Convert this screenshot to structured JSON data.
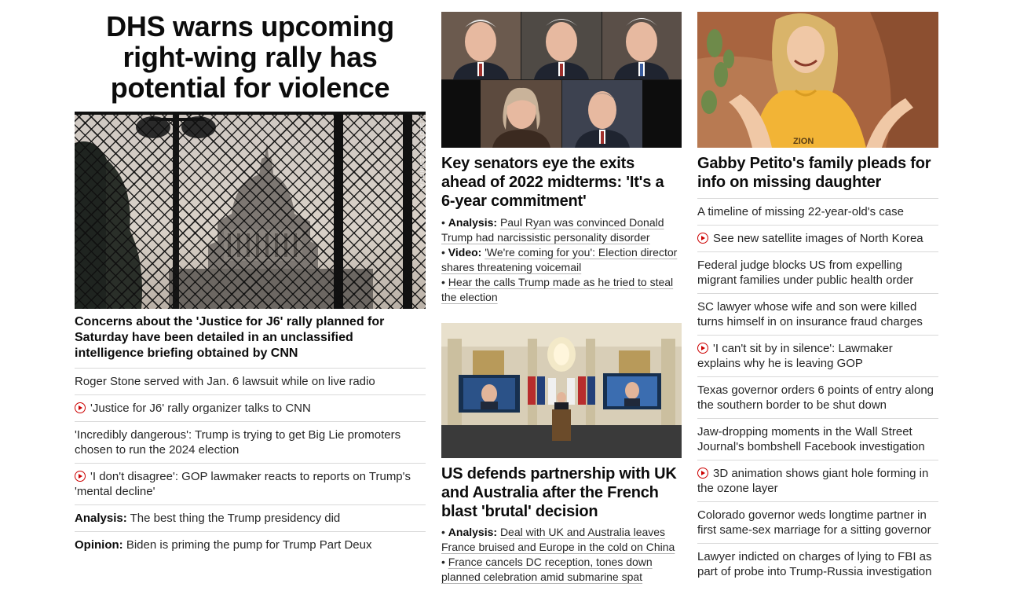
{
  "col1": {
    "title": "DHS warns upcoming right-wing rally has potential for violence",
    "image_credit": "J. SCOTT APPLEWHITE/AP",
    "caption": "Concerns about the 'Justice for J6' rally planned for Saturday have been detailed in an unclassified intelligence briefing obtained by CNN",
    "links": [
      {
        "label": "",
        "text": "Roger Stone served with Jan. 6 lawsuit while on live radio",
        "video": false
      },
      {
        "label": "",
        "text": "'Justice for J6' rally organizer talks to CNN",
        "video": true
      },
      {
        "label": "",
        "text": "'Incredibly dangerous': Trump is trying to get Big Lie promoters chosen to run the 2024 election",
        "video": false
      },
      {
        "label": "",
        "text": "'I don't disagree': GOP lawmaker reacts to reports on Trump's 'mental decline'",
        "video": true
      },
      {
        "label": "Analysis:",
        "text": "The best thing the Trump presidency did",
        "video": false
      },
      {
        "label": "Opinion:",
        "text": "Biden is priming the pump for Trump Part Deux",
        "video": false
      }
    ]
  },
  "col2": {
    "story1": {
      "headline": "Key senators eye the exits ahead of 2022 midterms: 'It's a 6-year commitment'",
      "bullets": [
        {
          "label": "Analysis:",
          "text": "Paul Ryan was convinced Donald Trump had narcissistic personality disorder"
        },
        {
          "label": "Video:",
          "text": "'We're coming for you': Election director shares threatening voicemail"
        },
        {
          "label": "",
          "text": "Hear the calls Trump made as he tried to steal the election"
        }
      ]
    },
    "story2": {
      "headline": "US defends partnership with UK and Australia after the French blast 'brutal' decision",
      "bullets": [
        {
          "label": "Analysis:",
          "text": "Deal with UK and Australia leaves France bruised and Europe in the cold on China"
        },
        {
          "label": "",
          "text": "France cancels DC reception, tones down planned celebration amid submarine spat"
        }
      ]
    }
  },
  "col3": {
    "image_shirt_text": "ZION",
    "headline": "Gabby Petito's family pleads for info on missing daughter",
    "links": [
      {
        "text": "A timeline of missing 22-year-old's case",
        "video": false
      },
      {
        "text": "See new satellite images of North Korea",
        "video": true
      },
      {
        "text": "Federal judge blocks US from expelling migrant families under public health order",
        "video": false
      },
      {
        "text": "SC lawyer whose wife and son were killed turns himself in on insurance fraud charges",
        "video": false
      },
      {
        "text": "'I can't sit by in silence': Lawmaker explains why he is leaving GOP",
        "video": true
      },
      {
        "text": "Texas governor orders 6 points of entry along the southern border to be shut down",
        "video": false
      },
      {
        "text": "Jaw-dropping moments in the Wall Street Journal's bombshell Facebook investigation",
        "video": false
      },
      {
        "text": "3D animation shows giant hole forming in the ozone layer",
        "video": true
      },
      {
        "text": "Colorado governor weds longtime partner in first same-sex marriage for a sitting governor",
        "video": false
      },
      {
        "text": "Lawyer indicted on charges of lying to FBI as part of probe into Trump-Russia investigation",
        "video": false
      }
    ]
  },
  "colors": {
    "video_red": "#cc0000",
    "divider": "#d9d9d9",
    "headline": "#0c0c0c",
    "body_text": "#262626"
  }
}
